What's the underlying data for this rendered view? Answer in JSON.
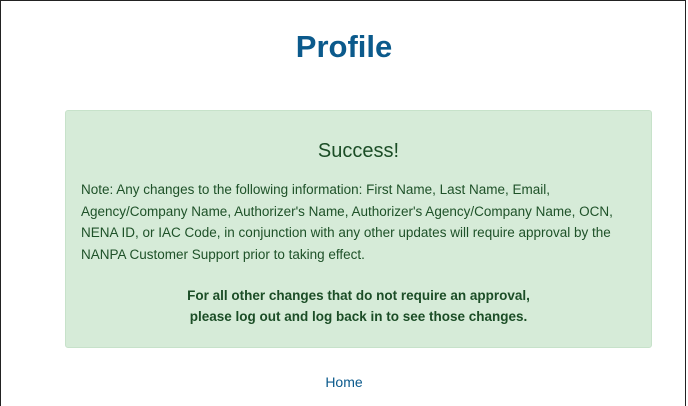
{
  "page": {
    "title": "Profile"
  },
  "alert": {
    "heading": "Success!",
    "note": "Note: Any changes to the following information: First Name, Last Name, Email, Agency/Company Name, Authorizer's Name, Authorizer's Agency/Company Name, OCN, NENA ID, or IAC Code, in conjunction with any other updates will require approval by the NANPA Customer Support prior to taking effect.",
    "emphasis_line_1": "For all other changes that do not require an approval,",
    "emphasis_line_2": "please log out and log back in to see those changes."
  },
  "links": {
    "home": "Home"
  },
  "colors": {
    "title": "#0b5a8c",
    "alert_bg": "#d6ebd8",
    "alert_text": "#1e5128",
    "link": "#0b5a8c"
  }
}
